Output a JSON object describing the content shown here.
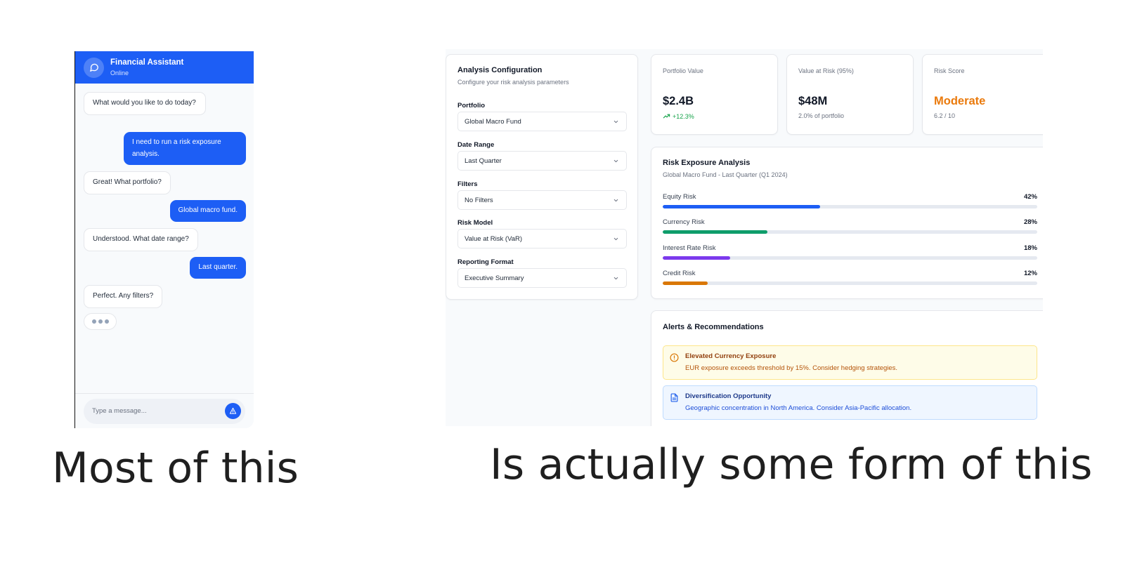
{
  "chat": {
    "title": "Financial Assistant",
    "status": "Online",
    "messages": [
      {
        "role": "bot",
        "text": "What would you like to do today?"
      },
      {
        "role": "user",
        "text": "I need to run a risk exposure analysis."
      },
      {
        "role": "bot",
        "text": "Great! What portfolio?"
      },
      {
        "role": "user",
        "text": "Global macro fund."
      },
      {
        "role": "bot",
        "text": "Understood. What date range?"
      },
      {
        "role": "user",
        "text": "Last quarter."
      },
      {
        "role": "bot",
        "text": "Perfect. Any filters?"
      }
    ],
    "input_placeholder": "Type a message...",
    "icons": {
      "avatar": "chat-bubble-icon",
      "send": "send-icon"
    }
  },
  "captions": {
    "left": "Most of this",
    "right": "Is actually some form of this"
  },
  "config": {
    "title": "Analysis Configuration",
    "subtitle": "Configure your risk analysis parameters",
    "fields": [
      {
        "label": "Portfolio",
        "value": "Global Macro Fund"
      },
      {
        "label": "Date Range",
        "value": "Last Quarter"
      },
      {
        "label": "Filters",
        "value": "No Filters"
      },
      {
        "label": "Risk Model",
        "value": "Value at Risk (VaR)"
      },
      {
        "label": "Reporting Format",
        "value": "Executive Summary"
      }
    ]
  },
  "stats": [
    {
      "label": "Portfolio Value",
      "value": "$2.4B",
      "note": "+12.3%",
      "value_color": "#111827",
      "note_color": "#16a34a"
    },
    {
      "label": "Value at Risk (95%)",
      "value": "$48M",
      "note": "2.0% of portfolio",
      "value_color": "#111827",
      "note_color": "#6b7280"
    },
    {
      "label": "Risk Score",
      "value": "Moderate",
      "note": "6.2 / 10",
      "value_color": "#ea7a0c",
      "note_color": "#6b7280"
    }
  ],
  "risk": {
    "title": "Risk Exposure Analysis",
    "subtitle": "Global Macro Fund - Last Quarter (Q1 2024)",
    "bars": [
      {
        "label": "Equity Risk",
        "pct_label": "42%",
        "fraction": 0.42,
        "color": "#1d5ef5"
      },
      {
        "label": "Currency Risk",
        "pct_label": "28%",
        "fraction": 0.28,
        "color": "#0f9d6b"
      },
      {
        "label": "Interest Rate Risk",
        "pct_label": "18%",
        "fraction": 0.18,
        "color": "#7c3aed"
      },
      {
        "label": "Credit Risk",
        "pct_label": "12%",
        "fraction": 0.12,
        "color": "#d97706"
      }
    ]
  },
  "alerts": {
    "title": "Alerts & Recommendations",
    "items": [
      {
        "title": "Elevated Currency Exposure",
        "text": "EUR exposure exceeds threshold by 15%. Consider hedging strategies.",
        "bg": "#fefce8",
        "border": "#fde68a",
        "title_color": "#92400e",
        "text_color": "#b45309",
        "icon": "alert-circle-icon"
      },
      {
        "title": "Diversification Opportunity",
        "text": "Geographic concentration in North America. Consider Asia-Pacific allocation.",
        "bg": "#eff6ff",
        "border": "#bfdbfe",
        "title_color": "#1e3a8a",
        "text_color": "#1d4ed8",
        "icon": "document-icon"
      }
    ]
  }
}
